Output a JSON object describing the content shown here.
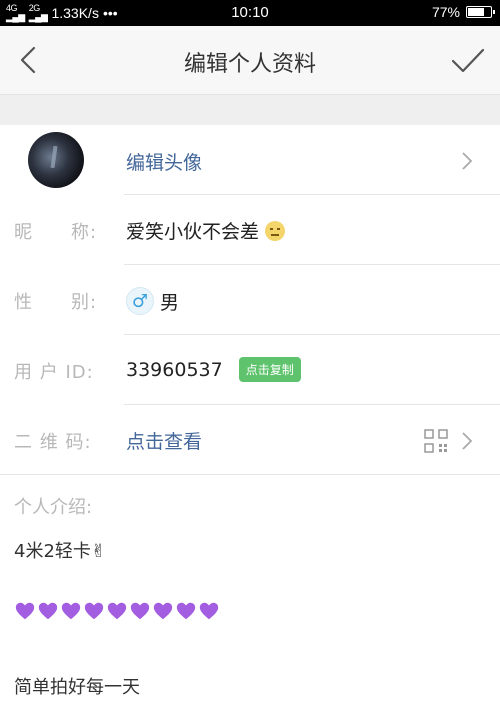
{
  "status_bar": {
    "network": "1.33K/s",
    "more": "•••",
    "time": "10:10",
    "battery_percent": "77%",
    "battery_level": 0.77
  },
  "nav": {
    "title": "编辑个人资料",
    "back_icon": "chevron-left-icon",
    "confirm_icon": "checkmark-icon"
  },
  "avatar_row": {
    "label": "编辑头像"
  },
  "nickname": {
    "label": "昵　　称:",
    "value": "爱笑小伙不会差",
    "emoji": "smiley-icon"
  },
  "gender": {
    "label": "性　　别:",
    "symbol": "♂",
    "value": "男"
  },
  "user_id": {
    "label": "用 户 ID:",
    "value": "33960537",
    "copy_label": "点击复制"
  },
  "qr_code": {
    "label": "二 维 码:",
    "value": "点击查看"
  },
  "intro": {
    "label": "个人介绍:",
    "lines": [
      "4米2轻卡✌",
      "简单拍好每一天"
    ],
    "heart_count": 9,
    "heart_color": "#a25de0"
  },
  "colors": {
    "link": "#44679a",
    "copy_badge": "#5fc36d"
  }
}
